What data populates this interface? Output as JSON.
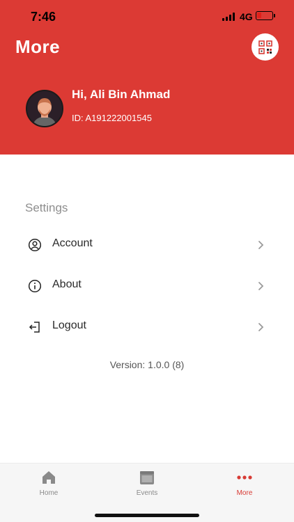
{
  "status_bar": {
    "time": "7:46",
    "network": "4G"
  },
  "header": {
    "title": "More",
    "greeting": "Hi, Ali Bin Ahmad",
    "user_id": "ID: A191222001545",
    "qr_icon": "qr-code-icon"
  },
  "settings": {
    "section_label": "Settings",
    "items": [
      {
        "label": "Account",
        "icon": "user-circle-icon"
      },
      {
        "label": "About",
        "icon": "info-icon"
      },
      {
        "label": "Logout",
        "icon": "logout-icon"
      }
    ]
  },
  "version": "Version: 1.0.0 (8)",
  "tabbar": {
    "tabs": [
      {
        "label": "Home",
        "icon": "home-icon"
      },
      {
        "label": "Events",
        "icon": "calendar-icon"
      },
      {
        "label": "More",
        "icon": "more-dots-icon",
        "active": true
      }
    ]
  },
  "colors": {
    "brand": "#dc3a34",
    "active_tab": "#d73a34",
    "inactive": "#8a8a8a"
  }
}
